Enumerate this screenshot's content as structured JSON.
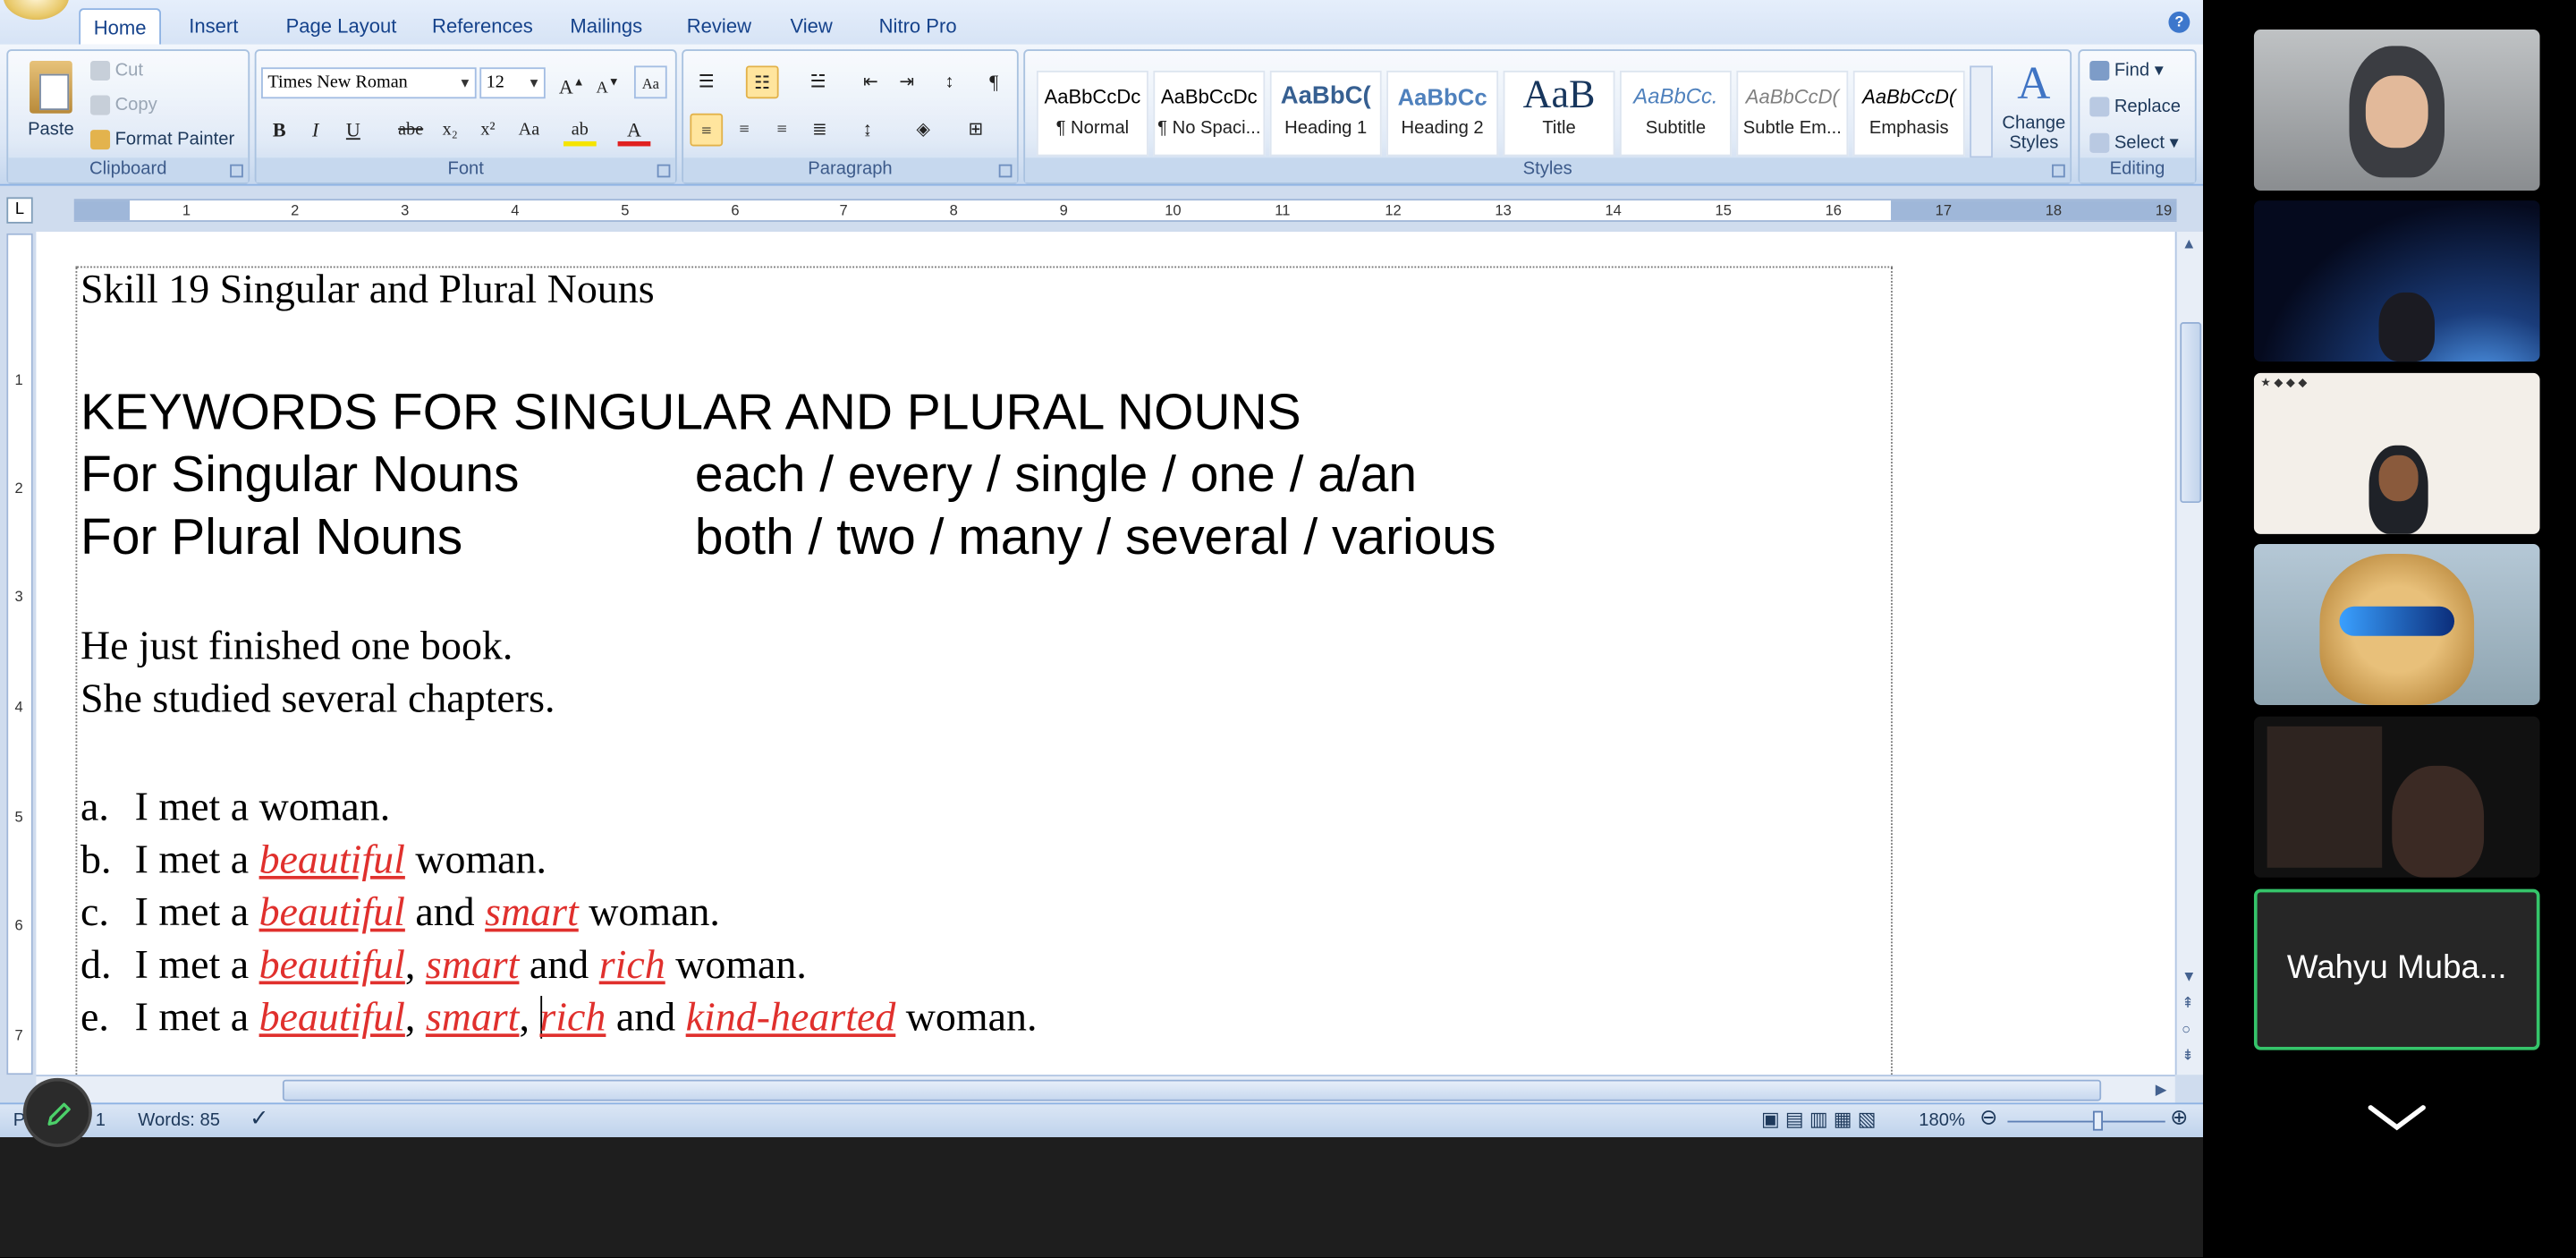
{
  "ribbon": {
    "tabs": [
      "Home",
      "Insert",
      "Page Layout",
      "References",
      "Mailings",
      "Review",
      "View",
      "Nitro Pro"
    ],
    "active_tab": "Home",
    "clipboard": {
      "paste": "Paste",
      "cut": "Cut",
      "copy": "Copy",
      "format_painter": "Format Painter",
      "label": "Clipboard"
    },
    "font": {
      "family": "Times New Roman",
      "size": "12",
      "label": "Font"
    },
    "paragraph": {
      "label": "Paragraph"
    },
    "styles": {
      "label": "Styles",
      "items": [
        {
          "preview": "AaBbCcDc",
          "name": "¶ Normal"
        },
        {
          "preview": "AaBbCcDc",
          "name": "¶ No Spaci..."
        },
        {
          "preview": "AaBbC(",
          "name": "Heading 1"
        },
        {
          "preview": "AaBbCc",
          "name": "Heading 2"
        },
        {
          "preview": "AaB",
          "name": "Title"
        },
        {
          "preview": "AaBbCc.",
          "name": "Subtitle"
        },
        {
          "preview": "AaBbCcD(",
          "name": "Subtle Em..."
        },
        {
          "preview": "AaBbCcD(",
          "name": "Emphasis"
        }
      ],
      "change_styles": "Change Styles"
    },
    "editing": {
      "find": "Find",
      "replace": "Replace",
      "select": "Select",
      "label": "Editing"
    }
  },
  "ruler": {
    "numbers": [
      "1",
      "2",
      "3",
      "4",
      "5",
      "6",
      "7",
      "8",
      "9",
      "10",
      "11",
      "12",
      "13",
      "14",
      "15",
      "16",
      "17",
      "18",
      "19"
    ]
  },
  "vruler": {
    "numbers": [
      "1",
      "2",
      "3",
      "4",
      "5",
      "6",
      "7"
    ]
  },
  "document": {
    "title": "Skill 19 Singular and Plural Nouns",
    "keywords_heading": "KEYWORDS FOR SINGULAR AND PLURAL NOUNS",
    "singular_label": "For Singular Nouns",
    "singular_words": "each / every / single / one / a/an",
    "plural_label": "For Plural Nouns",
    "plural_words": "both / two / many / several / various",
    "example1": "He just finished one book.",
    "example2": "She studied several chapters.",
    "list": {
      "a": {
        "marker": "a.",
        "pre": "I met a woman."
      },
      "b": {
        "marker": "b.",
        "pre": "I met a",
        "adj1": "beautiful",
        "post": "woman."
      },
      "c": {
        "marker": "c.",
        "pre": "I met a",
        "adj1": "beautiful",
        "and": "and",
        "adj2": "smart",
        "post": "woman."
      },
      "d": {
        "marker": "d.",
        "pre": "I met a",
        "adj1": "beautiful",
        "comma": ",",
        "adj2": "smart",
        "and": "and",
        "adj3": "rich",
        "post": "woman."
      },
      "e": {
        "marker": "e.",
        "pre": "I met a",
        "adj1": "beautiful",
        "comma": ",",
        "adj2": "smart",
        "comma2": ",",
        "adj3": "rich",
        "and": "and",
        "adj4": "kind-hearted",
        "post": "woman."
      }
    }
  },
  "status": {
    "page": "Page 1 of 1",
    "words": "Words: 85",
    "zoom": "180%"
  },
  "participants": [
    {
      "label": "participant-1"
    },
    {
      "label": "participant-2"
    },
    {
      "label": "participant-3"
    },
    {
      "label": "participant-4"
    },
    {
      "label": "participant-5"
    },
    {
      "name": "Wahyu Muba..."
    }
  ],
  "colors": {
    "adjective": "#e0302d",
    "active_speaker_border": "#35c46a",
    "ribbon_bg": "#dbe6f5"
  }
}
